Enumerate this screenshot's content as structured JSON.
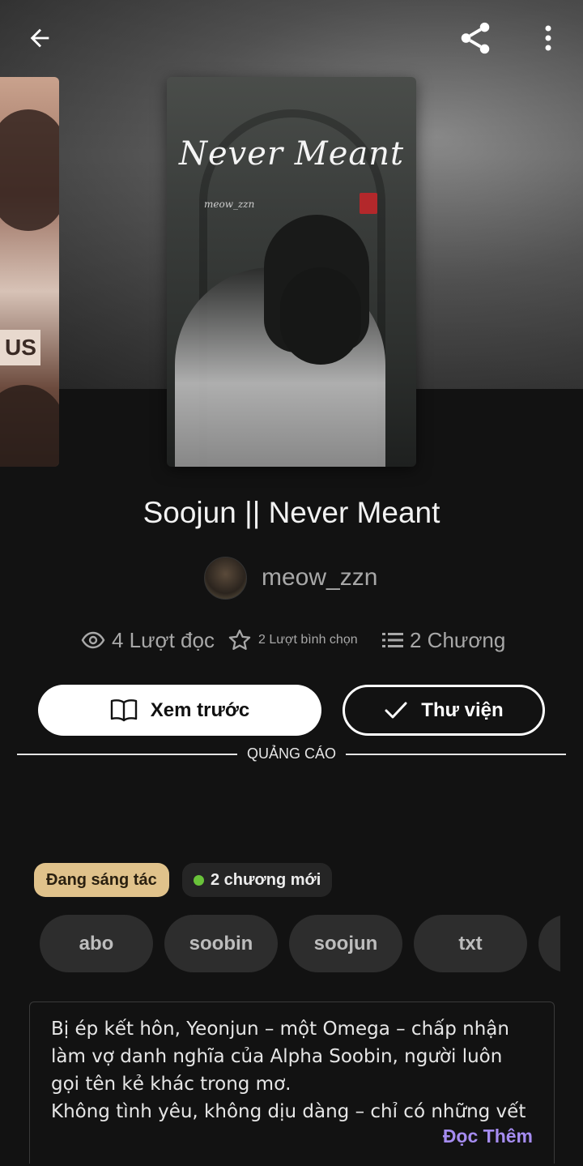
{
  "cover": {
    "title": "Never Meant",
    "author": "meow_zzn",
    "side_badge": "US"
  },
  "book": {
    "title": "Soojun || Never Meant",
    "author": "meow_zzn"
  },
  "stats": {
    "reads": "4 Lượt đọc",
    "votes": "2 Lượt bình chọn",
    "parts": "2 Chương"
  },
  "actions": {
    "preview_label": "Xem trước",
    "library_label": "Thư viện"
  },
  "ad": {
    "label": "QUẢNG CÁO"
  },
  "badges": {
    "status": "Đang sáng tác",
    "new_parts": "2 chương mới"
  },
  "tags": [
    "abo",
    "soobin",
    "soojun",
    "txt",
    ""
  ],
  "description": {
    "text": "Bị ép kết hôn, Yeonjun – một Omega – chấp nhận làm vợ danh nghĩa của Alpha Soobin, người luôn gọi tên kẻ khác trong mơ.\nKhông tình yêu, không dịu dàng – chỉ có những vết",
    "read_more": "Đọc Thêm"
  },
  "icons": {
    "back": "arrow-left-icon",
    "share": "share-icon",
    "more": "more-vertical-icon",
    "reads": "eye-icon",
    "votes": "star-icon",
    "parts": "list-icon",
    "preview": "book-open-icon",
    "library": "check-icon"
  },
  "colors": {
    "background": "#121212",
    "status_badge": "#e0c28b",
    "new_dot": "#69c23a",
    "read_more": "#a58cf0"
  }
}
